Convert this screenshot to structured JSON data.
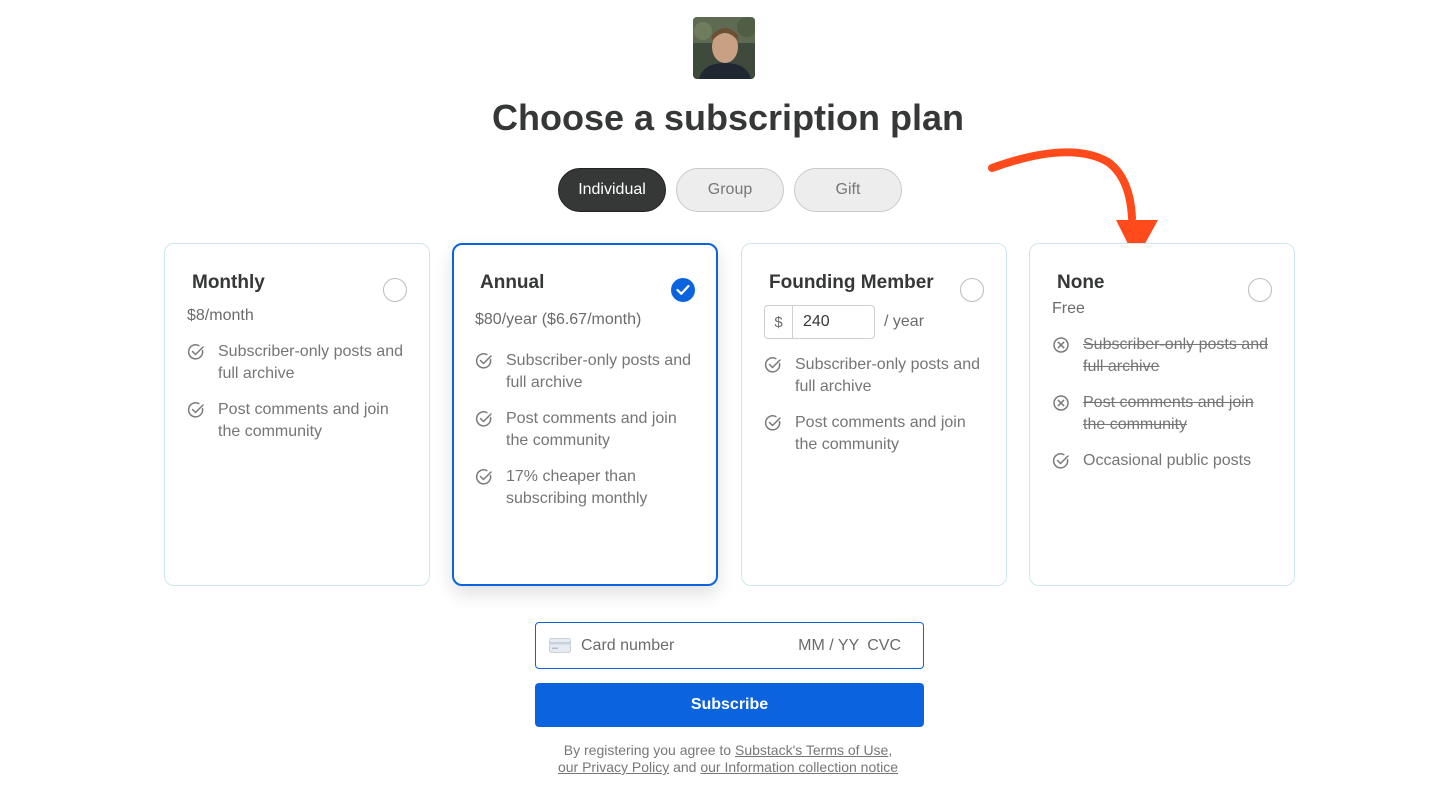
{
  "title": "Choose a subscription plan",
  "tabs": [
    {
      "label": "Individual",
      "active": true
    },
    {
      "label": "Group",
      "active": false
    },
    {
      "label": "Gift",
      "active": false
    }
  ],
  "plans": {
    "monthly": {
      "name": "Monthly",
      "price": "$8/month",
      "selected": false,
      "features": [
        {
          "text": "Subscriber-only posts and full archive",
          "included": true
        },
        {
          "text": "Post comments and join the community",
          "included": true
        }
      ]
    },
    "annual": {
      "name": "Annual",
      "price": "$80/year ($6.67/month)",
      "selected": true,
      "features": [
        {
          "text": "Subscriber-only posts and full archive",
          "included": true
        },
        {
          "text": "Post comments and join the community",
          "included": true
        },
        {
          "text": "17% cheaper than subscribing monthly",
          "included": true
        }
      ]
    },
    "founding": {
      "name": "Founding Member",
      "currency": "$",
      "amount": "240",
      "period": "/ year",
      "selected": false,
      "features": [
        {
          "text": "Subscriber-only posts and full archive",
          "included": true
        },
        {
          "text": "Post comments and join the community",
          "included": true
        }
      ]
    },
    "none": {
      "name": "None",
      "price": "Free",
      "selected": false,
      "features": [
        {
          "text": "Subscriber-only posts and full archive",
          "included": false
        },
        {
          "text": "Post comments and join the community",
          "included": false
        },
        {
          "text": "Occasional public posts",
          "included": true
        }
      ]
    }
  },
  "payment": {
    "card_placeholder": "Card number",
    "expiry_placeholder": "MM / YY",
    "cvc_placeholder": "CVC",
    "subscribe_label": "Subscribe"
  },
  "legal": {
    "prefix": "By registering you agree to",
    "terms_link": "Substack's Terms of Use",
    "comma": ",",
    "privacy_link": "our Privacy Policy",
    "and": "and",
    "info_link": "our Information collection notice"
  },
  "colors": {
    "accent": "#0b64dd",
    "annotation_arrow": "#ff4a1c",
    "text": "#363737",
    "muted": "#757575"
  },
  "icons": {
    "included": "check-circle-icon",
    "excluded": "x-circle-icon",
    "card": "credit-card-icon",
    "selected": "checkmark-icon"
  }
}
